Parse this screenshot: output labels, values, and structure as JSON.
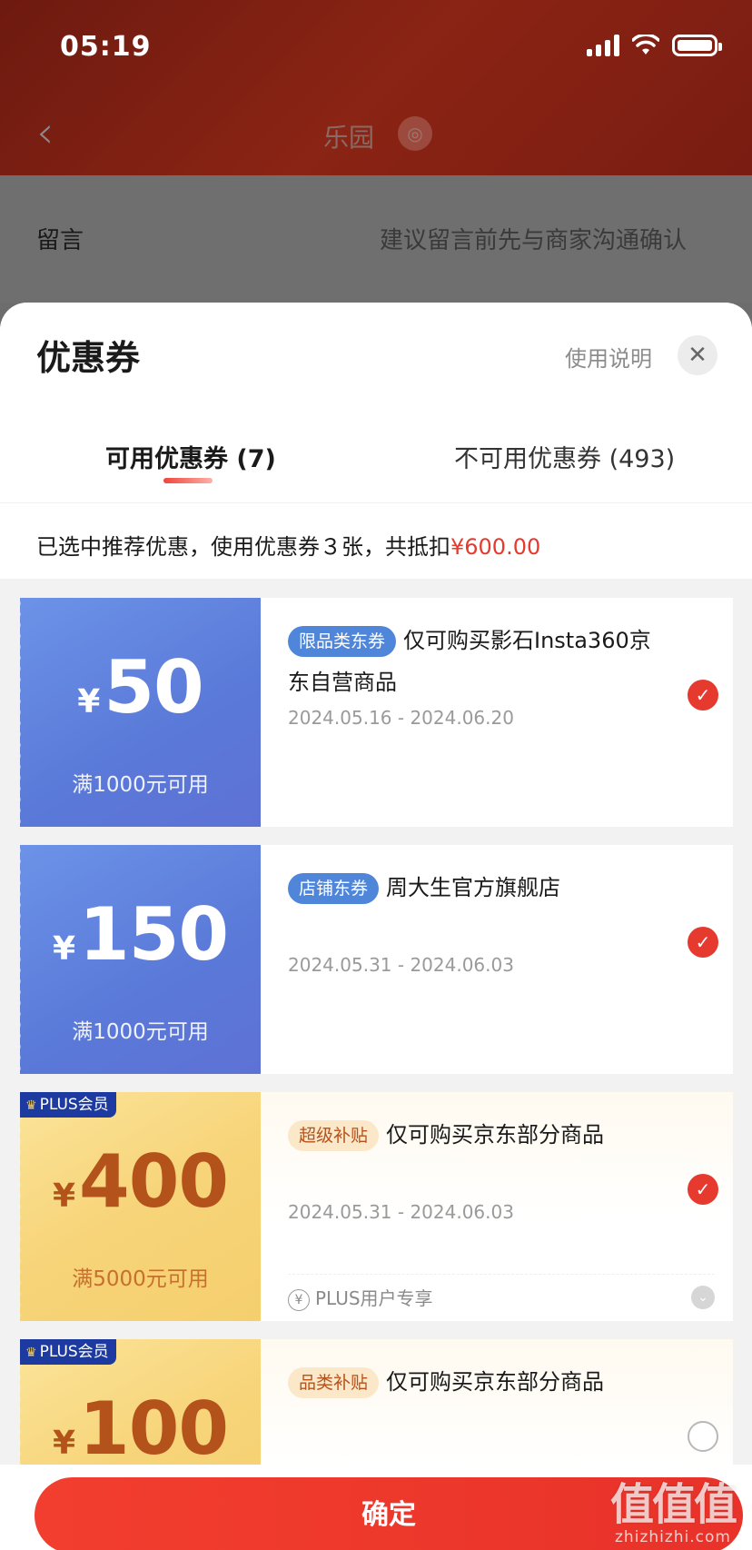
{
  "status_bar": {
    "time": "05:19"
  },
  "nav": {
    "title": "乐园",
    "back_icon": "chevron-left-icon",
    "pin_icon": "location-pin-icon"
  },
  "background": {
    "message_label": "留言",
    "message_hint": "建议留言前先与商家沟通确认"
  },
  "sheet": {
    "title": "优惠券",
    "help_label": "使用说明",
    "close_icon": "close-icon",
    "tabs": [
      {
        "label": "可用优惠券 (7)",
        "active": true
      },
      {
        "label": "不可用优惠券 (493)",
        "active": false
      }
    ],
    "summary_prefix": "已选中推荐优惠，使用优惠券３张，共抵扣",
    "summary_amount": "¥600.00"
  },
  "coupons": [
    {
      "currency": "¥",
      "amount": "50",
      "threshold": "满1000元可用",
      "badge": "限品类东券",
      "desc": "仅可购买影石Insta360京东自营商品",
      "dates": "2024.05.16 - 2024.06.20",
      "selected": true,
      "theme": "blue"
    },
    {
      "currency": "¥",
      "amount": "150",
      "threshold": "满1000元可用",
      "badge": "店铺东券",
      "desc": "周大生官方旗舰店",
      "dates": "2024.05.31 - 2024.06.03",
      "selected": true,
      "theme": "blue"
    },
    {
      "currency": "¥",
      "amount": "400",
      "threshold": "满5000元可用",
      "badge": "超级补贴",
      "desc": "仅可购买京东部分商品",
      "dates": "2024.05.31 - 2024.06.03",
      "selected": true,
      "theme": "gold",
      "plus_tag": "PLUS会员",
      "footer": "PLUS用户专享"
    },
    {
      "currency": "¥",
      "amount": "100",
      "threshold": "",
      "badge": "品类补贴",
      "desc": "仅可购买京东部分商品",
      "dates": "",
      "selected": false,
      "theme": "gold",
      "plus_tag": "PLUS会员"
    }
  ],
  "confirm_label": "确定",
  "watermark": {
    "logo": "值值值",
    "url": "zhizhizhi.com"
  },
  "colors": {
    "accent": "#e53a2d",
    "blue_coupon": "#5a79d8",
    "gold_coupon": "#f7d479"
  }
}
